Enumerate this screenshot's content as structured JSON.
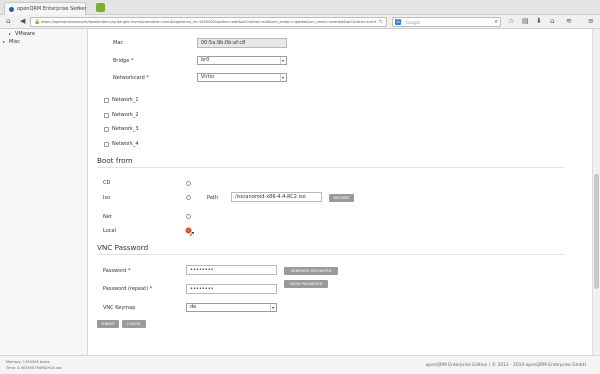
{
  "browser": {
    "tab_title": "openQRM Enterprise Server",
    "url": "https://openqrm/openqrm/base/index.php?plugin=kvm&controller=kvm&appliance_id=1495002&action=edit&strControl=edit&vm_action=update&vm_name=android&strControl=kvm&dmnz=true",
    "search_placeholder": "Google",
    "search_engine": "G"
  },
  "sidebar": {
    "items": [
      {
        "label": "VMware",
        "arrow": "▸"
      },
      {
        "label": "Misc",
        "arrow": "▸"
      }
    ]
  },
  "form": {
    "mac_label": "Mac",
    "mac_value": "00:5a:9b:0b:af:c8",
    "bridge_label": "Bridge *",
    "bridge_value": "br0",
    "networkcard_label": "Networkcard *",
    "networkcard_value": "Virtio",
    "networks": [
      "Network_1",
      "Network_2",
      "Network_3",
      "Network_4"
    ],
    "boot_heading": "Boot from",
    "boot_options": [
      {
        "label": "CD",
        "selected": false
      },
      {
        "label": "Iso",
        "selected": false
      },
      {
        "label": "Net",
        "selected": false
      },
      {
        "label": "Local",
        "selected": true
      }
    ],
    "path_label": "Path",
    "path_value": "/iso/android-x86-4.4-RC2.iso",
    "browse_label": "BROWSE",
    "vnc_heading": "VNC Password",
    "password_label": "Password *",
    "password_value": "••••••••",
    "password_repeat_label": "Password (repeat) *",
    "password_repeat_value": "••••••••",
    "generate_label": "GENERATE PASSWORD",
    "show_label": "SHOW PASSWORD",
    "keymap_label": "VNC Keymap",
    "keymap_value": "de",
    "submit_label": "SUBMIT",
    "cancel_label": "CANCEL"
  },
  "footer": {
    "memory": "Memory: 1790504 bytes",
    "time": "Time: 0.567650794982910 sec",
    "copyright": "openQRM Enterprise Edition | © 2012 - 2014 openQRM Enterprise GmbH"
  }
}
